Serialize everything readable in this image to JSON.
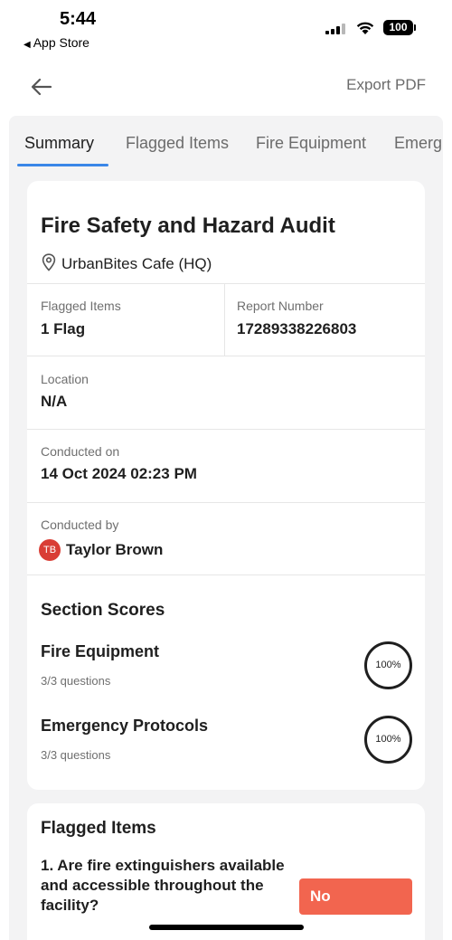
{
  "status_bar": {
    "time": "5:44",
    "back_app": "App Store",
    "battery": "100"
  },
  "nav": {
    "export_label": "Export PDF"
  },
  "tabs": [
    {
      "label": "Summary",
      "active": true
    },
    {
      "label": "Flagged Items",
      "active": false
    },
    {
      "label": "Fire Equipment",
      "active": false
    },
    {
      "label": "Emerg",
      "active": false
    }
  ],
  "report": {
    "title": "Fire Safety and Hazard Audit",
    "site": "UrbanBites Cafe (HQ)",
    "flagged_label": "Flagged Items",
    "flagged_value": "1 Flag",
    "report_number_label": "Report Number",
    "report_number_value": "17289338226803",
    "location_label": "Location",
    "location_value": "N/A",
    "conducted_on_label": "Conducted on",
    "conducted_on_value": "14 Oct 2024 02:23 PM",
    "conducted_by_label": "Conducted by",
    "conducted_by_initials": "TB",
    "conducted_by_name": "Taylor Brown"
  },
  "section_scores": {
    "heading": "Section Scores",
    "items": [
      {
        "name": "Fire Equipment",
        "questions": "3/3 questions",
        "score": "100%"
      },
      {
        "name": "Emergency Protocols",
        "questions": "3/3 questions",
        "score": "100%"
      }
    ]
  },
  "flagged": {
    "heading": "Flagged Items",
    "question": "1. Are fire extinguishers available and accessible throughout the facility?",
    "answer": "No"
  },
  "colors": {
    "accent_blue": "#3a86e8",
    "flag_red": "#f2654f",
    "avatar_red": "#d93d35"
  }
}
